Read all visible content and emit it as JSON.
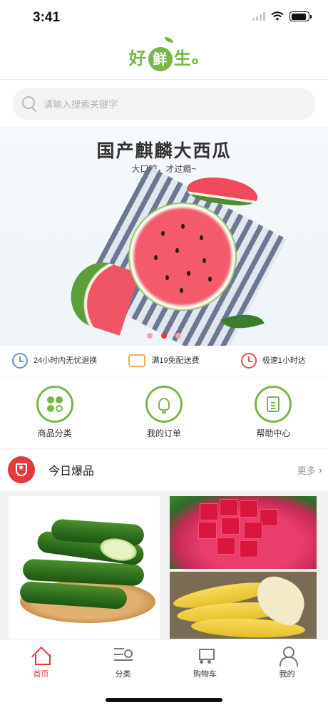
{
  "status": {
    "time": "3:41",
    "battery_level": 0.9
  },
  "header": {
    "logo_left": "好",
    "logo_mid": "鲜",
    "logo_right": "生"
  },
  "search": {
    "placeholder": "请输入搜索关键字",
    "icon": "search-icon"
  },
  "banner": {
    "title": "国产麒麟大西瓜",
    "subtitle": "大口咬，才过瘾~",
    "slide_count": 3,
    "active_slide": 1
  },
  "services": [
    {
      "icon": "clock-icon",
      "text": "24小时内无忧退换"
    },
    {
      "icon": "truck-icon",
      "text": "满19免配送费"
    },
    {
      "icon": "stopwatch-icon",
      "text": "极速1小时达"
    }
  ],
  "quick_entries": [
    {
      "icon": "clover-icon",
      "label": "商品分类"
    },
    {
      "icon": "bulb-icon",
      "label": "我的订单"
    },
    {
      "icon": "clipboard-icon",
      "label": "帮助中心"
    }
  ],
  "hot": {
    "title": "今日爆品",
    "more_label": "更多"
  },
  "tabbar": [
    {
      "icon": "home-icon",
      "label": "首页",
      "active": true
    },
    {
      "icon": "category-icon",
      "label": "分类",
      "active": false
    },
    {
      "icon": "cart-icon",
      "label": "购物车",
      "active": false
    },
    {
      "icon": "user-icon",
      "label": "我的",
      "active": false
    }
  ],
  "colors": {
    "brand_green": "#7ab648",
    "accent_red": "#e53a3a"
  }
}
